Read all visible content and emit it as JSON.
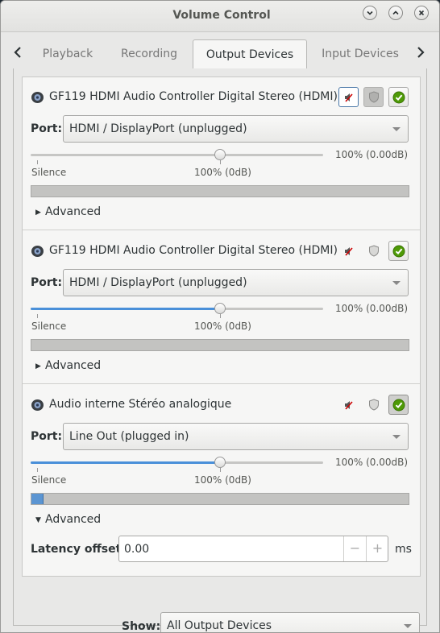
{
  "window": {
    "title": "Volume Control",
    "buttons": [
      "minimize",
      "maximize",
      "close"
    ]
  },
  "tabs": [
    {
      "label": "Playback",
      "active": false
    },
    {
      "label": "Recording",
      "active": false
    },
    {
      "label": "Output Devices",
      "active": true
    },
    {
      "label": "Input Devices",
      "active": false
    }
  ],
  "devices": [
    {
      "name": "GF119 HDMI Audio Controller Digital Stereo (HDMI)",
      "port_label": "Port:",
      "port_value": "HDMI / DisplayPort (unplugged)",
      "volume_percent": 100,
      "volume_text": "100% (0.00dB)",
      "silence_label": "Silence",
      "unity_label": "100% (0dB)",
      "level_fraction": 0,
      "advanced_label": "Advanced",
      "advanced_expanded": false,
      "slider_enabled": false,
      "mute_focused": true,
      "lock_disabled": true
    },
    {
      "name": "GF119 HDMI Audio Controller Digital Stereo (HDMI)",
      "port_label": "Port:",
      "port_value": "HDMI / DisplayPort (unplugged)",
      "volume_percent": 100,
      "volume_text": "100% (0.00dB)",
      "silence_label": "Silence",
      "unity_label": "100% (0dB)",
      "level_fraction": 0,
      "advanced_label": "Advanced",
      "advanced_expanded": false,
      "slider_enabled": true,
      "mute_focused": false,
      "lock_disabled": false
    },
    {
      "name": "Audio interne Stéréo analogique",
      "port_label": "Port:",
      "port_value": "Line Out (plugged in)",
      "volume_percent": 100,
      "volume_text": "100% (0.00dB)",
      "silence_label": "Silence",
      "unity_label": "100% (0dB)",
      "level_fraction": 0.03,
      "advanced_label": "Advanced",
      "advanced_expanded": true,
      "latency_label": "Latency offset:",
      "latency_value": "0.00",
      "latency_unit": "ms",
      "slider_enabled": true,
      "mute_focused": false,
      "lock_disabled": false,
      "default_pressed": true
    }
  ],
  "footer": {
    "show_label": "Show:",
    "show_value": "All Output Devices"
  },
  "colors": {
    "accent": "#4a90d9",
    "check_green": "#4e9a06",
    "mute_red": "#cc0000"
  },
  "icons": [
    "speaker-icon",
    "mute-icon",
    "lock-icon",
    "check-icon",
    "chevron-left-icon",
    "chevron-right-icon"
  ]
}
